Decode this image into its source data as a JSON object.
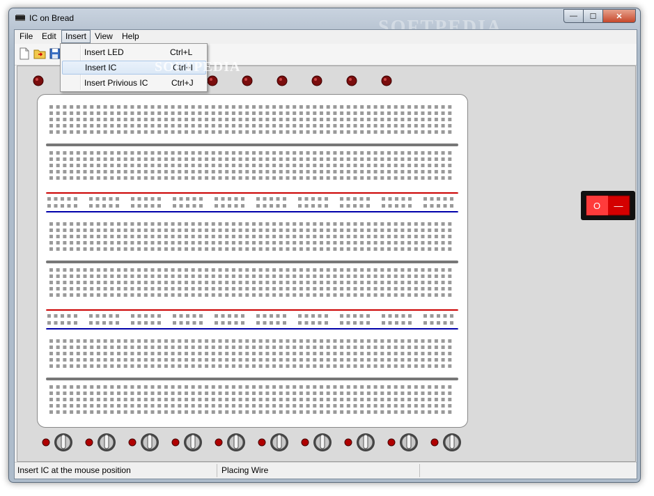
{
  "window": {
    "title": "IC on Bread",
    "controls": {
      "minimize": "—",
      "maximize": "☐",
      "close": "✕"
    }
  },
  "menubar": {
    "items": [
      {
        "label": "File"
      },
      {
        "label": "Edit"
      },
      {
        "label": "Insert"
      },
      {
        "label": "View"
      },
      {
        "label": "Help"
      }
    ]
  },
  "insert_menu": {
    "items": [
      {
        "label": "Insert LED",
        "shortcut": "Ctrl+L"
      },
      {
        "label": "Insert IC",
        "shortcut": "Ctrl+I"
      },
      {
        "label": "Insert Privious IC",
        "shortcut": "Ctrl+J"
      }
    ]
  },
  "toolbar": {
    "buttons": [
      {
        "icon": "new-file-icon"
      },
      {
        "icon": "open-folder-icon"
      },
      {
        "icon": "save-icon"
      }
    ]
  },
  "breadboard": {
    "top_leds_state": "off",
    "power_switch": {
      "on_label": "O",
      "off_label": "—"
    },
    "input_toggles": 10,
    "rail_colors": {
      "positive": "#cc0000",
      "negative": "#0000aa"
    }
  },
  "watermark": {
    "text": "SOFTPEDIA"
  },
  "statusbar": {
    "hint": "Insert IC at the mouse position",
    "mode": "Placing Wire",
    "extra": ""
  }
}
